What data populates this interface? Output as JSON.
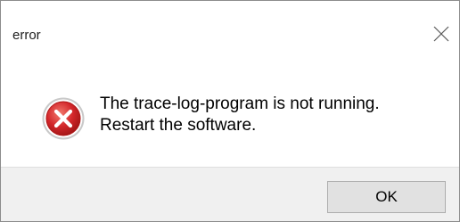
{
  "window": {
    "title": "error",
    "close_icon": "close-icon"
  },
  "content": {
    "icon": "error-icon",
    "message_line1": "The trace-log-program is not running.",
    "message_line2": "Restart the software."
  },
  "footer": {
    "ok_label": "OK"
  },
  "colors": {
    "footer_bg": "#f0f0f0",
    "button_bg": "#e1e1e1",
    "button_border": "#adadad",
    "error_red": "#d3272b"
  }
}
